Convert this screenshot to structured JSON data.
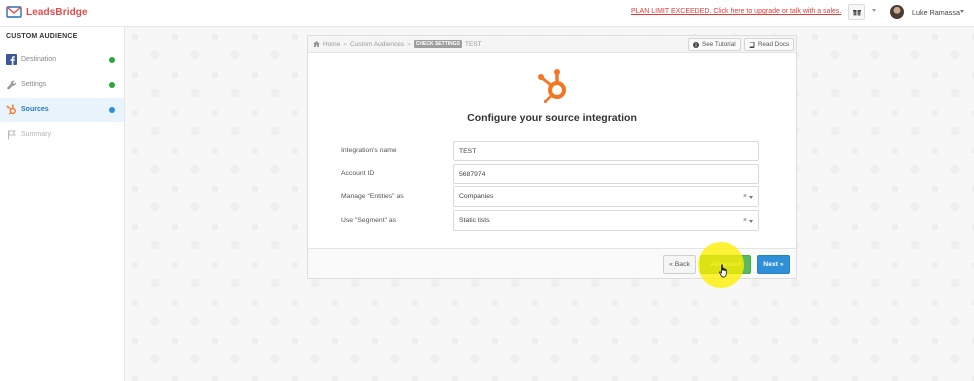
{
  "app": {
    "name": "LeadsBridge",
    "brand_color": "#e04b4b"
  },
  "topbar": {
    "plan_warning": "PLAN LIMIT EXCEEDED. Click here to upgrade or talk with a sales.",
    "gift_icon": "gift-icon",
    "user_name": "Luke Ramassa"
  },
  "sidebar": {
    "title": "CUSTOM AUDIENCE",
    "items": [
      {
        "label": "Destination",
        "icon": "facebook-icon",
        "status": "complete",
        "status_color": "#27a844"
      },
      {
        "label": "Settings",
        "icon": "wrench-icon",
        "status": "complete",
        "status_color": "#27a844"
      },
      {
        "label": "Sources",
        "icon": "hubspot-icon",
        "status": "current",
        "status_color": "#2a8fd8"
      },
      {
        "label": "Summary",
        "icon": "flag-icon",
        "status": "pending"
      }
    ]
  },
  "card": {
    "breadcrumb": {
      "home": "Home",
      "section": "Custom Audiences",
      "badge": "CHECK SETTINGS",
      "current": "TEST"
    },
    "see_tutorial": "See Tutorial",
    "read_docs": "Read Docs",
    "source_icon": "hubspot-icon",
    "title": "Configure your source integration",
    "fields": {
      "integration_name": {
        "label": "Integration's name",
        "value": "TEST"
      },
      "account_id": {
        "label": "Account ID",
        "value": "5687974"
      },
      "entities": {
        "label": "Manage \"Entities\" as",
        "value": "Companies"
      },
      "segment": {
        "label": "Use \"Segment\" as",
        "value": "Static lists"
      }
    },
    "buttons": {
      "back": "« Back",
      "advanced": "Advanced",
      "next": "Next »"
    }
  },
  "colors": {
    "accent_blue": "#2f8fd8",
    "success_green": "#5cb85c",
    "warning_red": "#e53935",
    "highlight_yellow": "#fff000"
  }
}
